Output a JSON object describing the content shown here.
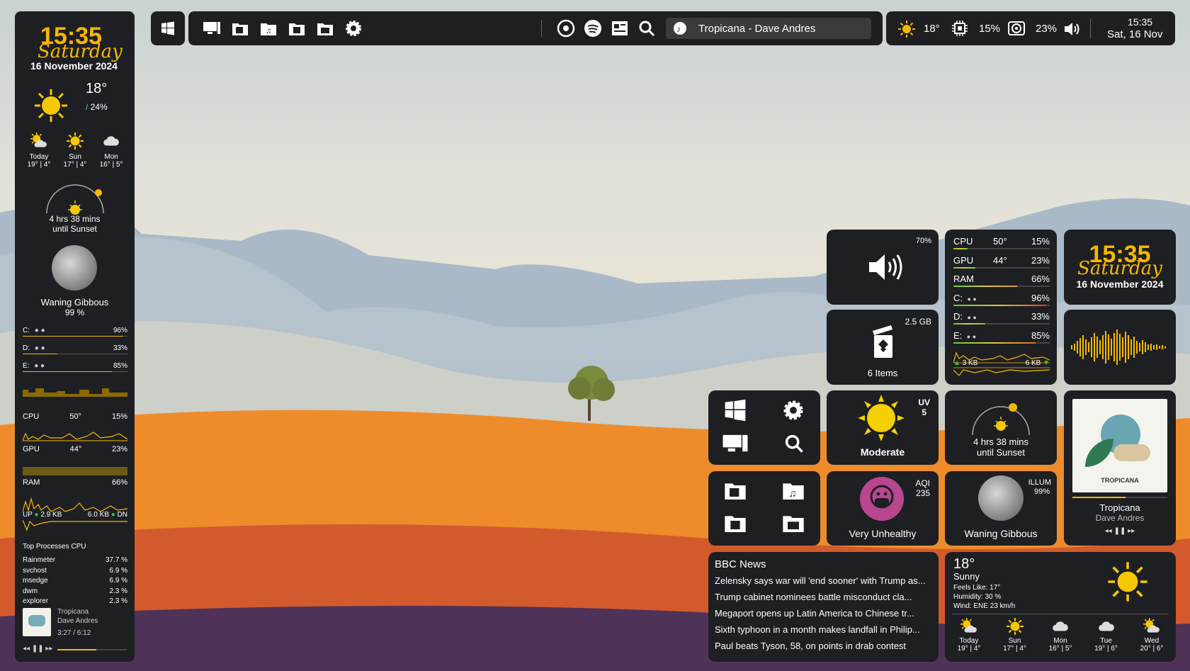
{
  "topbar": {
    "media": "Tropicana - Dave Andres",
    "temp": "18°",
    "cpu": "15%",
    "gpu": "23%",
    "volume_icon": "speaker-icon",
    "time": "15:35",
    "date": "Sat, 16 Nov"
  },
  "sidebar": {
    "clock": {
      "time": "15:35",
      "day": "Saturday",
      "date": "16 November 2024"
    },
    "weather": {
      "temp": "18°",
      "humidity": "24%"
    },
    "forecast": [
      {
        "day": "Today",
        "temps": "19° | 4°",
        "icon": "sun-cloud-icon"
      },
      {
        "day": "Sun",
        "temps": "17° | 4°",
        "icon": "sun-icon"
      },
      {
        "day": "Mon",
        "temps": "16° | 5°",
        "icon": "cloud-icon"
      }
    ],
    "sunset": {
      "line1": "4 hrs 38 mins",
      "line2": "until Sunset"
    },
    "moon": {
      "phase": "Waning Gibbous",
      "percent": "99 %"
    },
    "drives": [
      {
        "label": "C:",
        "value": "96%",
        "fill": 0.96
      },
      {
        "label": "D:",
        "value": "33%",
        "fill": 0.33
      },
      {
        "label": "E:",
        "value": "85%",
        "fill": 0.85
      }
    ],
    "cpu": {
      "label": "CPU",
      "temp": "50°",
      "value": "15%"
    },
    "gpu": {
      "label": "GPU",
      "temp": "44°",
      "value": "23%"
    },
    "ram": {
      "label": "RAM",
      "value": "66%"
    },
    "net": {
      "up_label": "UP",
      "up": "2.9 KB",
      "down": "6.0 KB",
      "down_label": "DN"
    },
    "processes_title": "Top Processes CPU",
    "processes": [
      {
        "name": "Rainmeter",
        "value": "37.7 %"
      },
      {
        "name": "svchost",
        "value": "6.9 %"
      },
      {
        "name": "msedge",
        "value": "6.9 %"
      },
      {
        "name": "dwm",
        "value": "2.3 %"
      },
      {
        "name": "explorer",
        "value": "2.3 %"
      }
    ],
    "player": {
      "title": "Tropicana",
      "artist": "Dave Andres",
      "time": "3:27 / 6:12",
      "progress": 0.56
    }
  },
  "tiles": {
    "volume": {
      "value": "70%"
    },
    "recycle": {
      "size": "2.5 GB",
      "items": "6 Items"
    },
    "sys": [
      {
        "label": "CPU",
        "temp": "50°",
        "value": "15%",
        "fill": 0.15
      },
      {
        "label": "GPU",
        "temp": "44°",
        "value": "23%",
        "fill": 0.23
      },
      {
        "label": "RAM",
        "temp": "",
        "value": "66%",
        "fill": 0.66
      },
      {
        "label": "C:",
        "temp": "",
        "value": "96%",
        "fill": 0.96
      },
      {
        "label": "D:",
        "temp": "",
        "value": "33%",
        "fill": 0.33
      },
      {
        "label": "E:",
        "temp": "",
        "value": "85%",
        "fill": 0.85
      }
    ],
    "net": {
      "up": "3 KB",
      "down": "6 KB"
    },
    "clock": {
      "time": "15:35",
      "day": "Saturday",
      "date": "16 November 2024"
    },
    "uv": {
      "label": "UV",
      "value": "5",
      "level": "Moderate"
    },
    "sunset": {
      "line1": "4 hrs 38 mins",
      "line2": "until Sunset"
    },
    "aqi": {
      "label": "AQI",
      "value": "235",
      "level": "Very Unhealthy"
    },
    "moon": {
      "label": "ILLUM",
      "value": "99%",
      "phase": "Waning Gibbous"
    },
    "album": {
      "cover_text": "TROPICANA",
      "title": "Tropicana",
      "artist": "Dave Andres",
      "progress": 0.56
    },
    "news": {
      "title": "BBC News",
      "items": [
        "Zelensky says war will 'end sooner' with Trump as...",
        "Trump cabinet nominees battle misconduct cla...",
        "Megaport opens up Latin America to Chinese tr...",
        "Sixth typhoon in a month makes landfall in Philip...",
        "Paul beats Tyson, 58, on points in drab contest"
      ]
    },
    "weather": {
      "temp": "18°",
      "cond": "Sunny",
      "feels": "Feels Like:  17°",
      "humidity": "Humidity:  30 %",
      "wind": "Wind:  ENE 23 km/h",
      "forecast": [
        {
          "day": "Today",
          "temps": "19° | 4°",
          "icon": "sun-cloud-icon"
        },
        {
          "day": "Sun",
          "temps": "17° | 4°",
          "icon": "sun-icon"
        },
        {
          "day": "Mon",
          "temps": "16° | 5°",
          "icon": "cloud-icon"
        },
        {
          "day": "Tue",
          "temps": "19° | 6°",
          "icon": "cloud-icon"
        },
        {
          "day": "Wed",
          "temps": "20° | 6°",
          "icon": "sun-cloud-icon"
        }
      ]
    }
  }
}
